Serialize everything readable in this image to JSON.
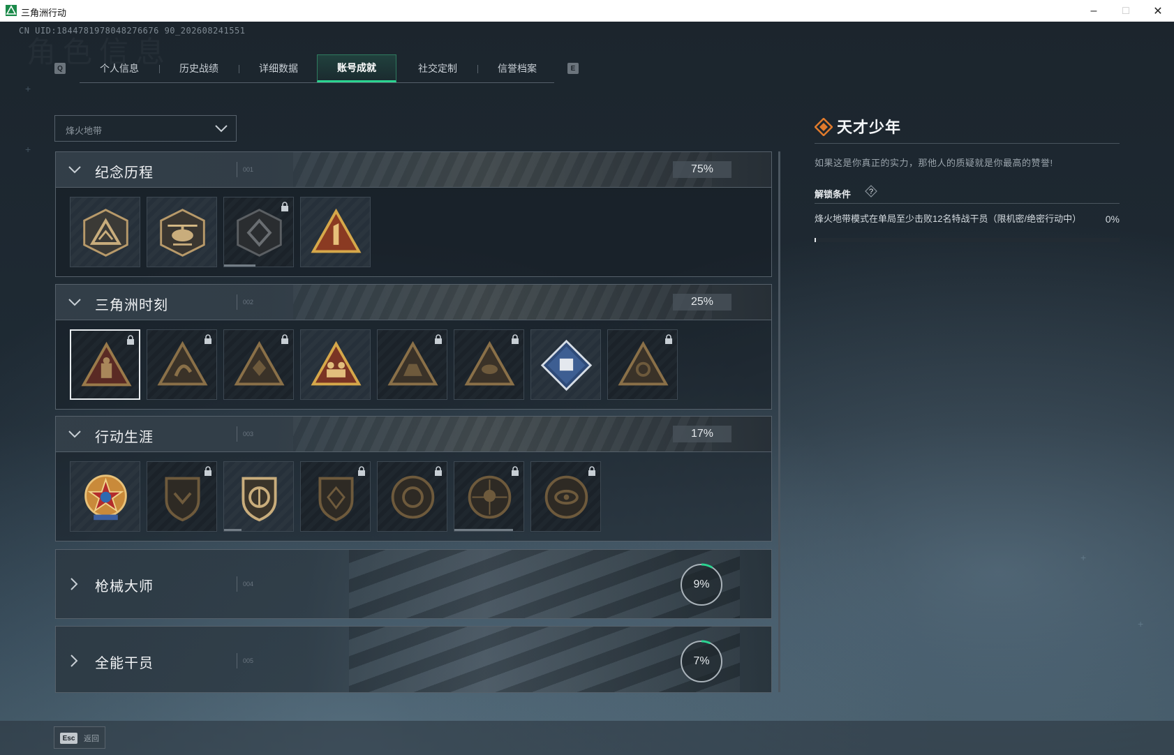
{
  "window": {
    "title": "三角洲行动",
    "minimize": "–",
    "maximize": "□",
    "close": "✕"
  },
  "header": {
    "uid": "CN UID:1844781978048276676 90_202608241551",
    "bg_text": "角色信息"
  },
  "tabs": {
    "prev_key": "Q",
    "next_key": "E",
    "items": [
      {
        "label": "个人信息"
      },
      {
        "label": "历史战绩"
      },
      {
        "label": "详细数据"
      },
      {
        "label": "账号成就"
      },
      {
        "label": "社交定制"
      },
      {
        "label": "信誉档案"
      }
    ],
    "active_index": 3
  },
  "mode_select": {
    "value": "烽火地带"
  },
  "sections": [
    {
      "title": "纪念历程",
      "num": "001",
      "percent": "75%",
      "expanded": true,
      "badges": [
        {
          "icon": "triangle-mountain-badge",
          "locked": false,
          "tone": "bronze"
        },
        {
          "icon": "helicopter-badge",
          "locked": false,
          "tone": "bronze"
        },
        {
          "icon": "shield-core-badge",
          "locked": true,
          "tone": "dark",
          "progress": 0.45
        },
        {
          "icon": "number-one-badge",
          "locked": false,
          "tone": "gold"
        }
      ]
    },
    {
      "title": "三角洲时刻",
      "num": "002",
      "percent": "25%",
      "expanded": true,
      "badges": [
        {
          "icon": "figure-triangle-badge",
          "locked": true,
          "selected": true,
          "tone": "red"
        },
        {
          "icon": "runner-triangle-badge",
          "locked": true,
          "tone": "dark"
        },
        {
          "icon": "gem-triangle-badge",
          "locked": true,
          "tone": "dark"
        },
        {
          "icon": "squad-triangle-badge",
          "locked": false,
          "tone": "gold"
        },
        {
          "icon": "beast-triangle-badge",
          "locked": true,
          "tone": "dark"
        },
        {
          "icon": "fish-triangle-badge",
          "locked": true,
          "tone": "dark"
        },
        {
          "icon": "crate-diamond-badge",
          "locked": false,
          "tone": "blue"
        },
        {
          "icon": "skull-triangle-badge",
          "locked": true,
          "tone": "dark"
        }
      ]
    },
    {
      "title": "行动生涯",
      "num": "003",
      "percent": "17%",
      "expanded": true,
      "badges": [
        {
          "icon": "star-crest-badge",
          "locked": false,
          "tone": "colorful"
        },
        {
          "icon": "wing-shield-badge",
          "locked": true,
          "tone": "dark"
        },
        {
          "icon": "compass-shield-badge",
          "locked": false,
          "tone": "bronze",
          "progress": 0.25
        },
        {
          "icon": "gem-shield-badge",
          "locked": true,
          "tone": "dark"
        },
        {
          "icon": "ring-seal-badge",
          "locked": true,
          "tone": "dark"
        },
        {
          "icon": "skull-seal-badge",
          "locked": true,
          "tone": "dark",
          "progress": 0.85
        },
        {
          "icon": "eye-seal-badge",
          "locked": true,
          "tone": "dark"
        }
      ]
    },
    {
      "title": "枪械大师",
      "num": "004",
      "percent": "9%",
      "progress": 0.09,
      "expanded": false
    },
    {
      "title": "全能干员",
      "num": "005",
      "percent": "7%",
      "progress": 0.07,
      "expanded": false
    }
  ],
  "detail": {
    "title": "天才少年",
    "description": "如果这是你真正的实力，那他人的质疑就是你最高的赞誉!",
    "unlock_label": "解锁条件",
    "help": "?",
    "condition": "烽火地带模式在单局至少击败12名特战干员（限机密/绝密行动中）",
    "condition_percent": "0%",
    "condition_progress": 0.0
  },
  "footer": {
    "esc_key": "Esc",
    "back_label": "返回"
  },
  "colors": {
    "accent": "#2bd491",
    "detail_icon": "#e07a2c",
    "bronze": "#b89a6a",
    "gold": "#d6a84a",
    "red": "#7a2a22"
  }
}
